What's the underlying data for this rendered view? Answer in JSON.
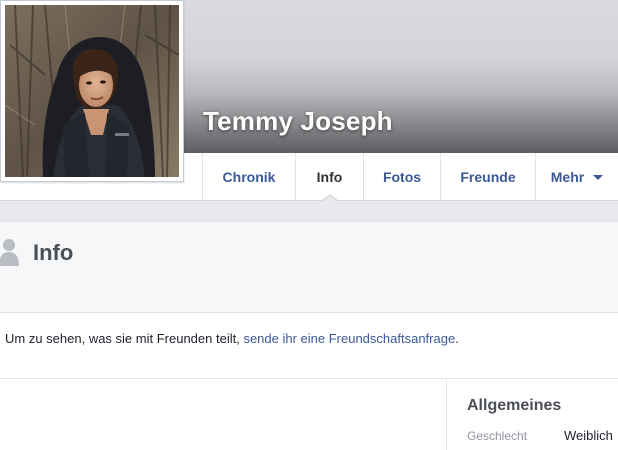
{
  "profile": {
    "name": "Temmy Joseph"
  },
  "tabs": [
    {
      "label": "Chronik",
      "active": false
    },
    {
      "label": "Info",
      "active": true
    },
    {
      "label": "Fotos",
      "active": false
    },
    {
      "label": "Freunde",
      "active": false
    },
    {
      "label": "Mehr",
      "active": false,
      "has_dropdown": true
    }
  ],
  "info_section": {
    "title": "Info",
    "icon": "person-silhouette-icon"
  },
  "friend_prompt": {
    "text_before": "Um zu sehen, was sie mit Freunden teilt, ",
    "link": "sende ihr eine Freundschaftsanfrage",
    "text_after": "."
  },
  "general": {
    "title": "Allgemeines",
    "rows": [
      {
        "label": "Geschlecht",
        "value": "Weiblich"
      }
    ]
  },
  "colors": {
    "link": "#3b5998",
    "page_gray": "#e9eaed",
    "header_bg": "#f6f7f8"
  }
}
